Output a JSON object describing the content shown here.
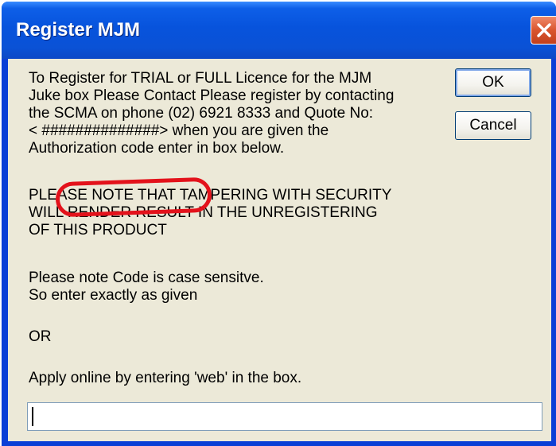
{
  "window": {
    "title": "Register MJM"
  },
  "buttons": {
    "ok": "OK",
    "cancel": "Cancel"
  },
  "message": {
    "para1": [
      "To Register for TRIAL or FULL Licence for the MJM",
      "Juke box Please Contact Please register by contacting",
      "the SCMA on phone (02) 6921 8333 and Quote No:",
      "< ##############> when you are given the",
      "Authorization code enter in box below."
    ],
    "para2": [
      "PLEASE NOTE THAT TAMPERING WITH SECURITY",
      "WILL RENDER RESULT IN THE UNREGISTERING",
      "OF THIS PRODUCT"
    ],
    "para3": [
      "Please note Code is case sensitve.",
      "So enter exactly as given"
    ],
    "para4": "OR",
    "para5": "Apply online by entering 'web' in the box."
  },
  "code_input": {
    "value": ""
  },
  "colors": {
    "titlebar": "#0753dc",
    "client": "#ece9d8",
    "annotation": "#e3121b",
    "close": "#d9552e"
  },
  "icons": {
    "close": "close-icon"
  }
}
